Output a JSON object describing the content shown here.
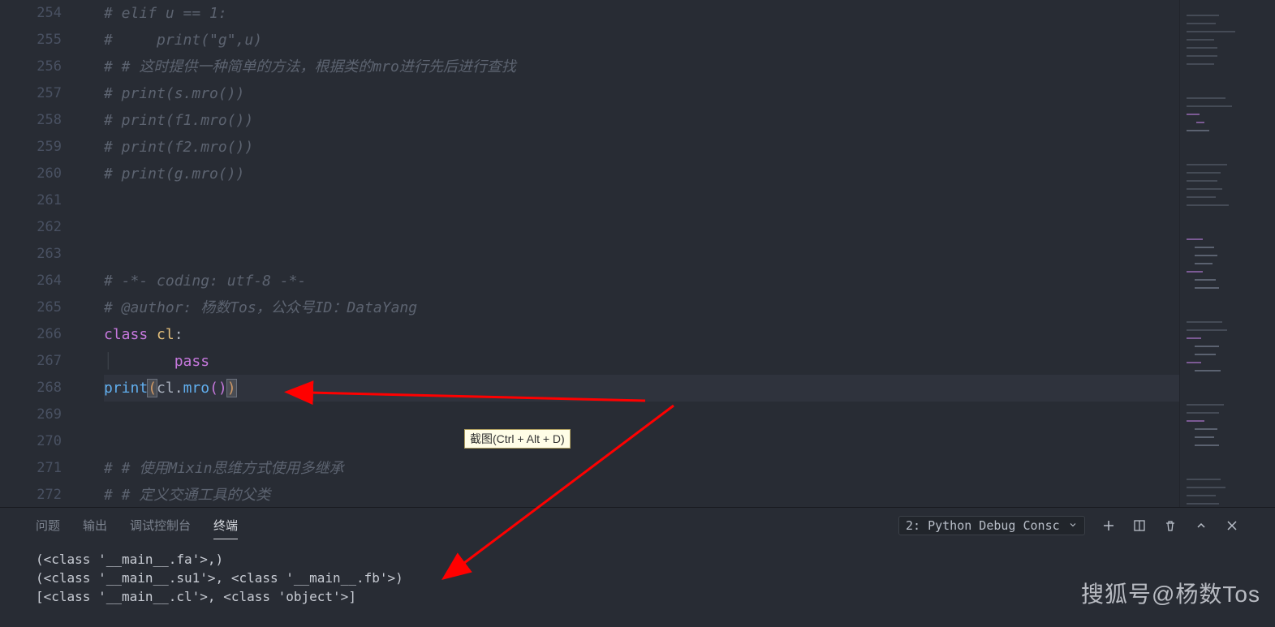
{
  "lines": {
    "start": 254,
    "end": 272
  },
  "code": {
    "l254": "# elif u == 1:",
    "l255": "#     print(\"g\",u)",
    "l256": "# # 这时提供一种简单的方法，根据类的mro进行先后进行查找",
    "l257": "# print(s.mro())",
    "l258": "# print(f1.mro())",
    "l259": "# print(f2.mro())",
    "l260": "# print(g.mro())",
    "l264": "# -*- coding: utf-8 -*-",
    "l265": "# @author: 杨数Tos，公众号ID：DataYang",
    "l266_class": "class",
    "l266_name": "cl",
    "l267_pass": "pass",
    "l268_print": "print",
    "l268_cl": "cl",
    "l268_mro": "mro",
    "l271": "# # 使用Mixin思维方式使用多继承",
    "l272": "# # 定义交通工具的父类"
  },
  "tooltip": "截图(Ctrl + Alt + D)",
  "panel": {
    "tabs": [
      "问题",
      "输出",
      "调试控制台",
      "终端"
    ],
    "active": 3,
    "dropdown": "2: Python Debug Consc"
  },
  "terminal": {
    "l1": "(<class '__main__.fa'>,)",
    "l2": "(<class '__main__.su1'>, <class '__main__.fb'>)",
    "l3": "[<class '__main__.cl'>, <class 'object'>]"
  },
  "watermark": "搜狐号@杨数Tos"
}
